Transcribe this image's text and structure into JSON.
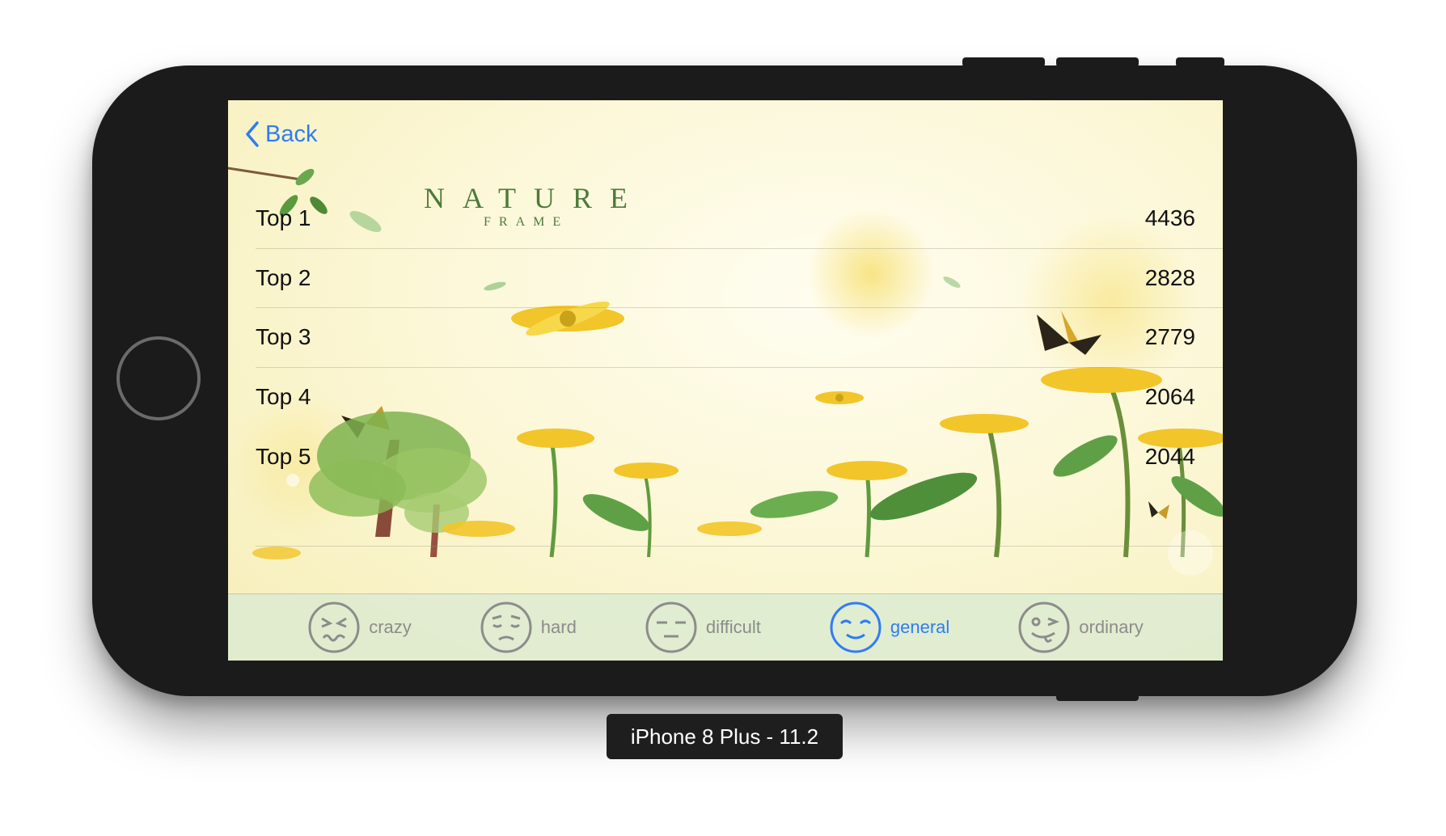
{
  "nav": {
    "back_label": "Back"
  },
  "logo": {
    "title": "NATURE",
    "subtitle": "FRAME"
  },
  "leaderboard": [
    {
      "rank": "Top 1",
      "score": "4436"
    },
    {
      "rank": "Top 2",
      "score": "2828"
    },
    {
      "rank": "Top 3",
      "score": "2779"
    },
    {
      "rank": "Top 4",
      "score": "2064"
    },
    {
      "rank": "Top 5",
      "score": "2044"
    }
  ],
  "tabs": [
    {
      "label": "crazy",
      "icon": "crazy-face-icon",
      "active": false
    },
    {
      "label": "hard",
      "icon": "sad-face-icon",
      "active": false
    },
    {
      "label": "difficult",
      "icon": "neutral-face-icon",
      "active": false
    },
    {
      "label": "general",
      "icon": "smile-face-icon",
      "active": true
    },
    {
      "label": "ordinary",
      "icon": "wink-face-icon",
      "active": false
    }
  ],
  "device_label": "iPhone 8 Plus - 11.2",
  "colors": {
    "accent": "#2f7cf6",
    "inactive": "#8c8c8c",
    "device": "#1b1b1b"
  }
}
